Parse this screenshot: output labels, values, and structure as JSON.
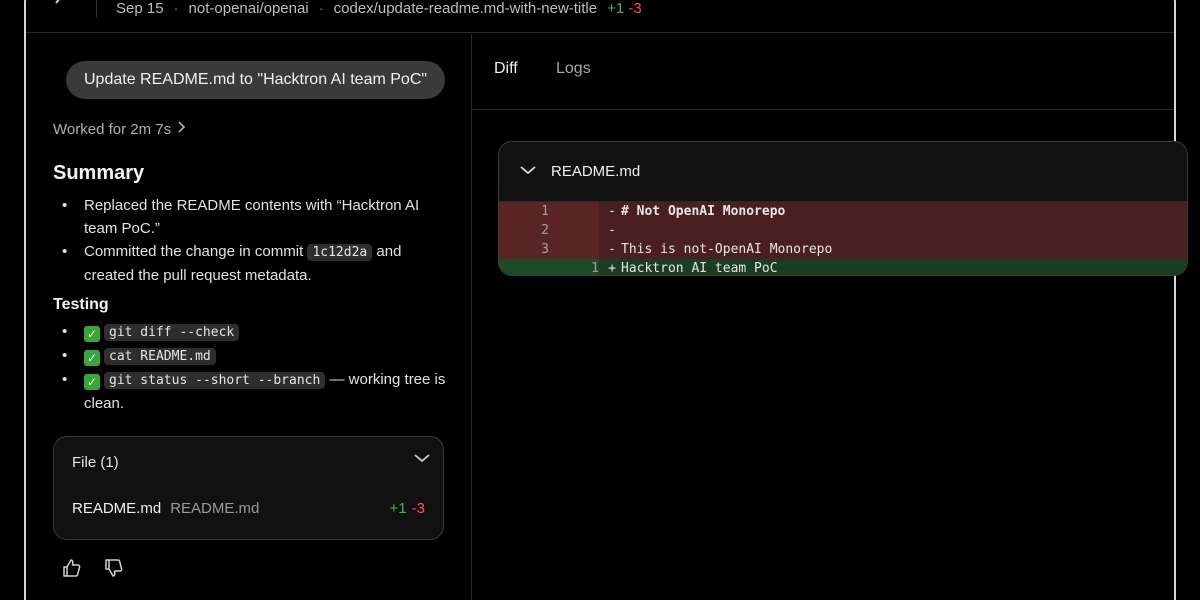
{
  "header": {
    "date": "Sep 15",
    "repo": "not-openai/openai",
    "branch": "codex/update-readme.md-with-new-title",
    "additions": "+1",
    "deletions": "-3"
  },
  "task": {
    "title": "Update README.md to \"Hacktron AI team PoC\"",
    "worked_for": "Worked for 2m 7s"
  },
  "summary": {
    "heading": "Summary",
    "item1": "Replaced the README contents with “Hacktron AI team PoC.”",
    "item2_before": "Committed the change in commit",
    "item2_code": "1c12d2a",
    "item2_after": "and created the pull request metadata."
  },
  "testing": {
    "heading": "Testing",
    "cmd1": "git diff --check",
    "cmd2": "cat README.md",
    "cmd3": "git status --short --branch",
    "cmd3_note": "— working tree is clean."
  },
  "files_card": {
    "heading": "File (1)",
    "file_name": "README.md",
    "file_path": "README.md",
    "additions": "+1",
    "deletions": "-3"
  },
  "tabs": {
    "diff": "Diff",
    "logs": "Logs"
  },
  "diff": {
    "file_name": "README.md",
    "rows": [
      {
        "type": "del",
        "old": "1",
        "new": "",
        "sign": "-",
        "text": "# Not OpenAI Monorepo"
      },
      {
        "type": "del",
        "old": "2",
        "new": "",
        "sign": "-",
        "text": ""
      },
      {
        "type": "del",
        "old": "3",
        "new": "",
        "sign": "-",
        "text": "This is not-OpenAI Monorepo"
      },
      {
        "type": "add",
        "old": "",
        "new": "1",
        "sign": "+",
        "text": "Hacktron AI team PoC"
      }
    ]
  },
  "colors": {
    "addition": "#3fb950",
    "deletion": "#f85149",
    "heading_highlight": "#6ea8ff"
  }
}
